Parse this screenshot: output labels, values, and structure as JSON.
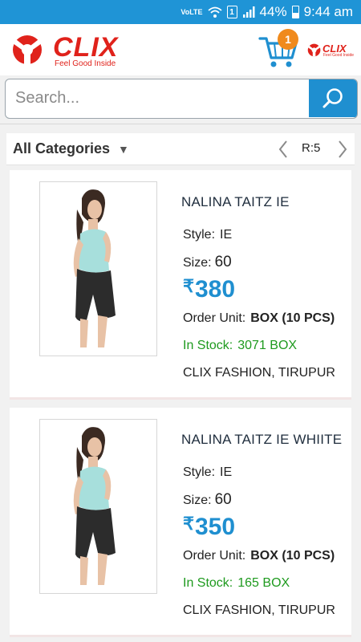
{
  "status_bar": {
    "network": "VoLTE",
    "sim": "1",
    "battery": "44%",
    "time": "9:44 am"
  },
  "header": {
    "brand": "CLIX",
    "tagline": "Feel Good Inside",
    "cart_count": "1",
    "brand_small": "CLIX",
    "brand_small_tagline": "Feel Good Inside",
    "accent_color": "#1f8fd0",
    "brand_color": "#e0221b"
  },
  "search": {
    "placeholder": "Search..."
  },
  "category_bar": {
    "label": "All Categories",
    "pager_label": "R:5"
  },
  "products": [
    {
      "name": "NALINA TAITZ IE",
      "style_label": "Style:",
      "style": "IE",
      "size_label": "Size:",
      "size": "60",
      "currency": "₹",
      "price": "380",
      "unit_label": "Order Unit:",
      "unit": "BOX (10 PCS)",
      "stock_label": "In Stock:",
      "stock": "3071 BOX",
      "seller": "CLIX FASHION, TIRUPUR"
    },
    {
      "name": "NALINA TAITZ IE WHIITE",
      "style_label": "Style:",
      "style": "IE",
      "size_label": "Size:",
      "size": "60",
      "currency": "₹",
      "price": "350",
      "unit_label": "Order Unit:",
      "unit": "BOX (10 PCS)",
      "stock_label": "In Stock:",
      "stock": "165 BOX",
      "seller": "CLIX FASHION, TIRUPUR"
    }
  ]
}
